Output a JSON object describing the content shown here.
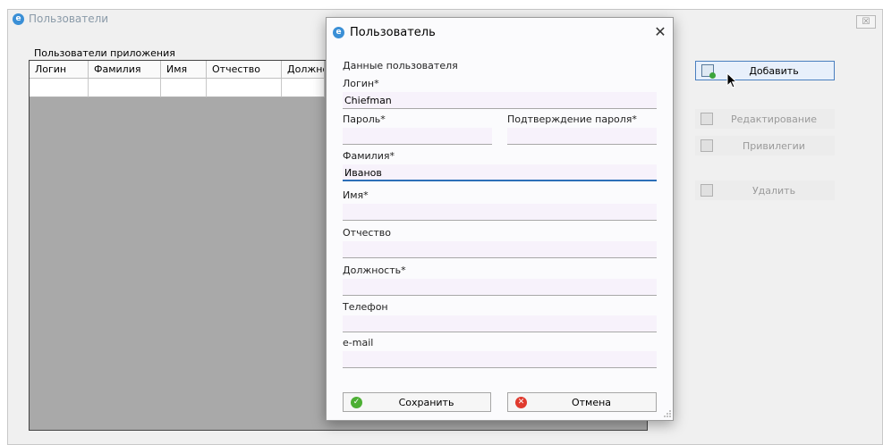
{
  "background_window": {
    "title": "Пользователи",
    "close_glyph": "☒",
    "grid_group_label": "Пользователи приложения",
    "columns": [
      "Логин",
      "Фамилия",
      "Имя",
      "Отчество",
      "Должно"
    ]
  },
  "side_buttons": {
    "add_label": "Добавить",
    "edit_label": "Редактирование",
    "privileges_label": "Привилегии",
    "delete_label": "Удалить"
  },
  "dialog": {
    "title": "Пользователь",
    "close_glyph": "✕",
    "section_label": "Данные пользователя",
    "login_label": "Логин*",
    "login_value": "Chiefman",
    "password_label": "Пароль*",
    "password_value": "",
    "password_confirm_label": "Подтверждение пароля*",
    "password_confirm_value": "",
    "lastname_label": "Фамилия*",
    "lastname_value": "Иванов",
    "firstname_label": "Имя*",
    "firstname_value": "",
    "middlename_label": "Отчество",
    "middlename_value": "",
    "position_label": "Должность*",
    "position_value": "",
    "phone_label": "Телефон",
    "phone_value": "",
    "email_label": "e-mail",
    "email_value": "",
    "save_label": "Сохранить",
    "cancel_label": "Отмена"
  },
  "colors": {
    "accent": "#2c6fb8",
    "field_bg": "#f7f2fb",
    "grid_bg": "#a9a9a9",
    "save_icon": "#4caf33",
    "cancel_icon": "#e03a2e"
  }
}
